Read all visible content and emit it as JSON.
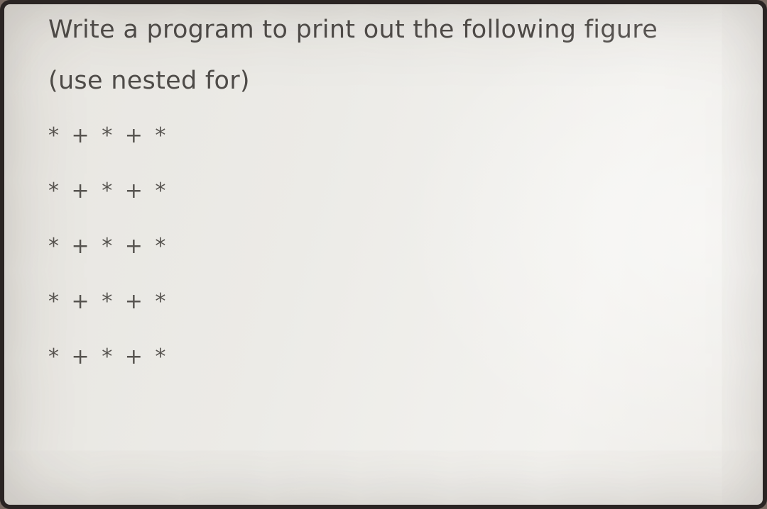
{
  "heading": {
    "line1": "Write a program to print out the following figure",
    "line2": "(use nested for)"
  },
  "pattern": {
    "rows": [
      "* + * + *",
      "* + * + *",
      "* + * + *",
      "* + * + *",
      "* + * + *"
    ]
  }
}
